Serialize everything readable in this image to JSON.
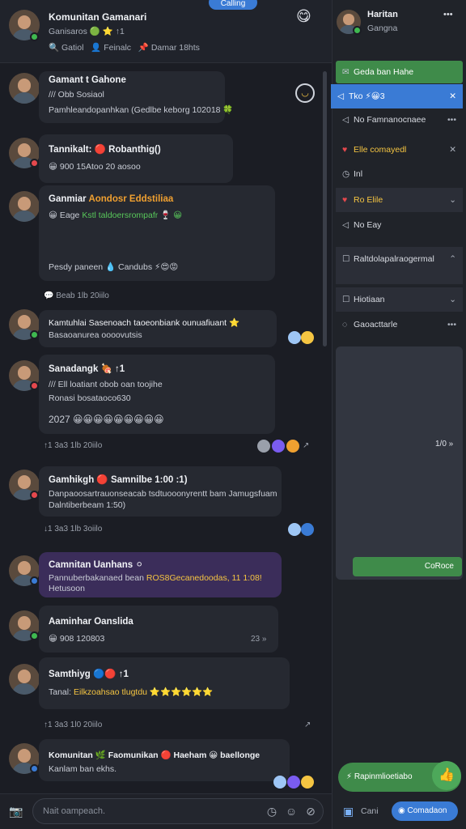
{
  "header": {
    "top_pill": "Calling",
    "title": "Komunitan Gamanari",
    "subtitle": "Ganisaros 🟢 ⭐ ↑1",
    "tabs": [
      "Gatiol",
      "Feinalc",
      "Damar 18hts"
    ]
  },
  "messages": [
    {
      "name": "Gamant t Gahone",
      "line1": "/// Obb Sosiaol",
      "line2": "Pamhleandopanhkan (Gedlbe keborg 102018 🍀"
    },
    {
      "name": "Tannikalt: 🔴 Robanthig()",
      "line1": "😀 900 15Atoo 20 aosoo"
    },
    {
      "name": "Ganmiar",
      "name_accent": "Aondosr Eddstiliaa",
      "line1": "😀 Eage",
      "line1_accent": "Kstl taldoersrompafr 🍷 😀",
      "footer": "Pesdy paneen 💧 Candubs ⚡😍😡"
    },
    {
      "separator": "💬 Beab 1lb 20iilo"
    },
    {
      "name": "Kamtuhlai Sasenoach taoeonbiank ounuafiuant ⭐",
      "line1": "Basaoanurea oooovutsis"
    },
    {
      "name": "Sanadangk 🍖 ↑1",
      "line1": "/// Ell loatiant obob oan toojihe",
      "line2": "Ronasi bosataoco630",
      "line3": "2027 😀😀😀😀😀😀😀😀😀",
      "meta": "↑1 3a3 1lb 20iilo"
    },
    {
      "name": "Gamhikgh 🔴 Samnilbe 1:00 :1)",
      "line1": "Danpaoosartrauonseacab tsdtuooonyrentt bam Jamugsfuam",
      "line2": "Dalntiberbeam 1:50)",
      "meta": "↓1 3a3 1lb 3oiilo"
    },
    {
      "name": "Camnitan Uanhans ⚪",
      "line1": "Pannuberbakanaed bean",
      "line1_accent": "ROS8Gecanedoodas, 11 1:08!",
      "line2": "Hetusoon"
    },
    {
      "name": "Aaminhar Oanslida",
      "line1": "😀 908 120803",
      "trail": "23 »"
    },
    {
      "name": "Samthiyg 🔵🔴 ↑1",
      "line1": "Tanal:",
      "line1_accent": "Eilkzoahsao tlugtdu ⭐⭐⭐⭐⭐⭐",
      "meta": "↑1 3a3 1l0 20iilo"
    },
    {
      "name": "Komunitan 🌿 Faomunikan 🔴 Haeham 😀 baellonge",
      "line1": "Kanlam ban ekhs."
    }
  ],
  "input": {
    "placeholder": "Nait oampeach."
  },
  "right": {
    "user_name": "Haritan",
    "user_status": "Gangna",
    "menu": "•••",
    "items": [
      {
        "label": "Geda ban Hahe",
        "style": "green"
      },
      {
        "label": "Tko ⚡😀3",
        "style": "selected",
        "trail": "✕"
      },
      {
        "label": "No Famnanocnaee",
        "trail": "•••"
      },
      {
        "label": "Elle comayedl",
        "style": "yellow",
        "trail": "✕"
      },
      {
        "label": "Inl"
      },
      {
        "label": "Ro Elile",
        "style": "dark",
        "trail": "⌄"
      },
      {
        "label": "No Eay"
      },
      {
        "label": "Raltdolapalraogermal",
        "style": "dark",
        "trail": "⌃"
      },
      {
        "label": "Hiotiaan",
        "style": "dark",
        "trail": "⌄"
      },
      {
        "label": "Gaoacttarle",
        "trail": "•••"
      }
    ],
    "panel_counter": "1/0 »",
    "panel_button": "CoRoce",
    "bottom_green": "Rapinmlioetiabo",
    "bottom_left": "Cani",
    "bottom_right": "Comadaon"
  }
}
